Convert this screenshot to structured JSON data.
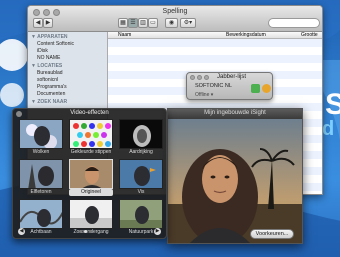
{
  "finder": {
    "title": "Spelling",
    "columns": [
      "Naam",
      "Bewerkingsdatum",
      "Grootte"
    ],
    "sections": [
      {
        "header": "▼ APPARATEN",
        "items": [
          "Content Softonic",
          "iDisk",
          "NO NAME"
        ]
      },
      {
        "header": "▼ LOCATIES",
        "items": [
          "Bureaublad",
          "softonicnl",
          "Programma's",
          "Documenten"
        ]
      },
      {
        "header": "▼ ZOEK NAAR",
        "items": []
      }
    ]
  },
  "jabber": {
    "title": "Jabber-lijst",
    "name": "SOFTONIC NL",
    "status": "Offline ▾"
  },
  "isight": {
    "title": "Mijn ingebouwde iSight",
    "prefs_button": "Voorkeuren..."
  },
  "effects": {
    "title": "Video-effecten",
    "items": [
      {
        "label": "Wolken",
        "icon": "clouds"
      },
      {
        "label": "Gekleurde stippen",
        "icon": "colored-dots"
      },
      {
        "label": "Aardrijking",
        "icon": "earth-glow"
      },
      {
        "label": "Elfletoren",
        "icon": "eiffel-tower"
      },
      {
        "label": "Origineel",
        "icon": "original"
      },
      {
        "label": "Vis",
        "icon": "fish"
      },
      {
        "label": "Achtbaan",
        "icon": "rollercoaster"
      },
      {
        "label": "Zonsondergang",
        "icon": "sunset"
      },
      {
        "label": "Natuurpark",
        "icon": "nature-park"
      }
    ],
    "selected_index": 4
  }
}
